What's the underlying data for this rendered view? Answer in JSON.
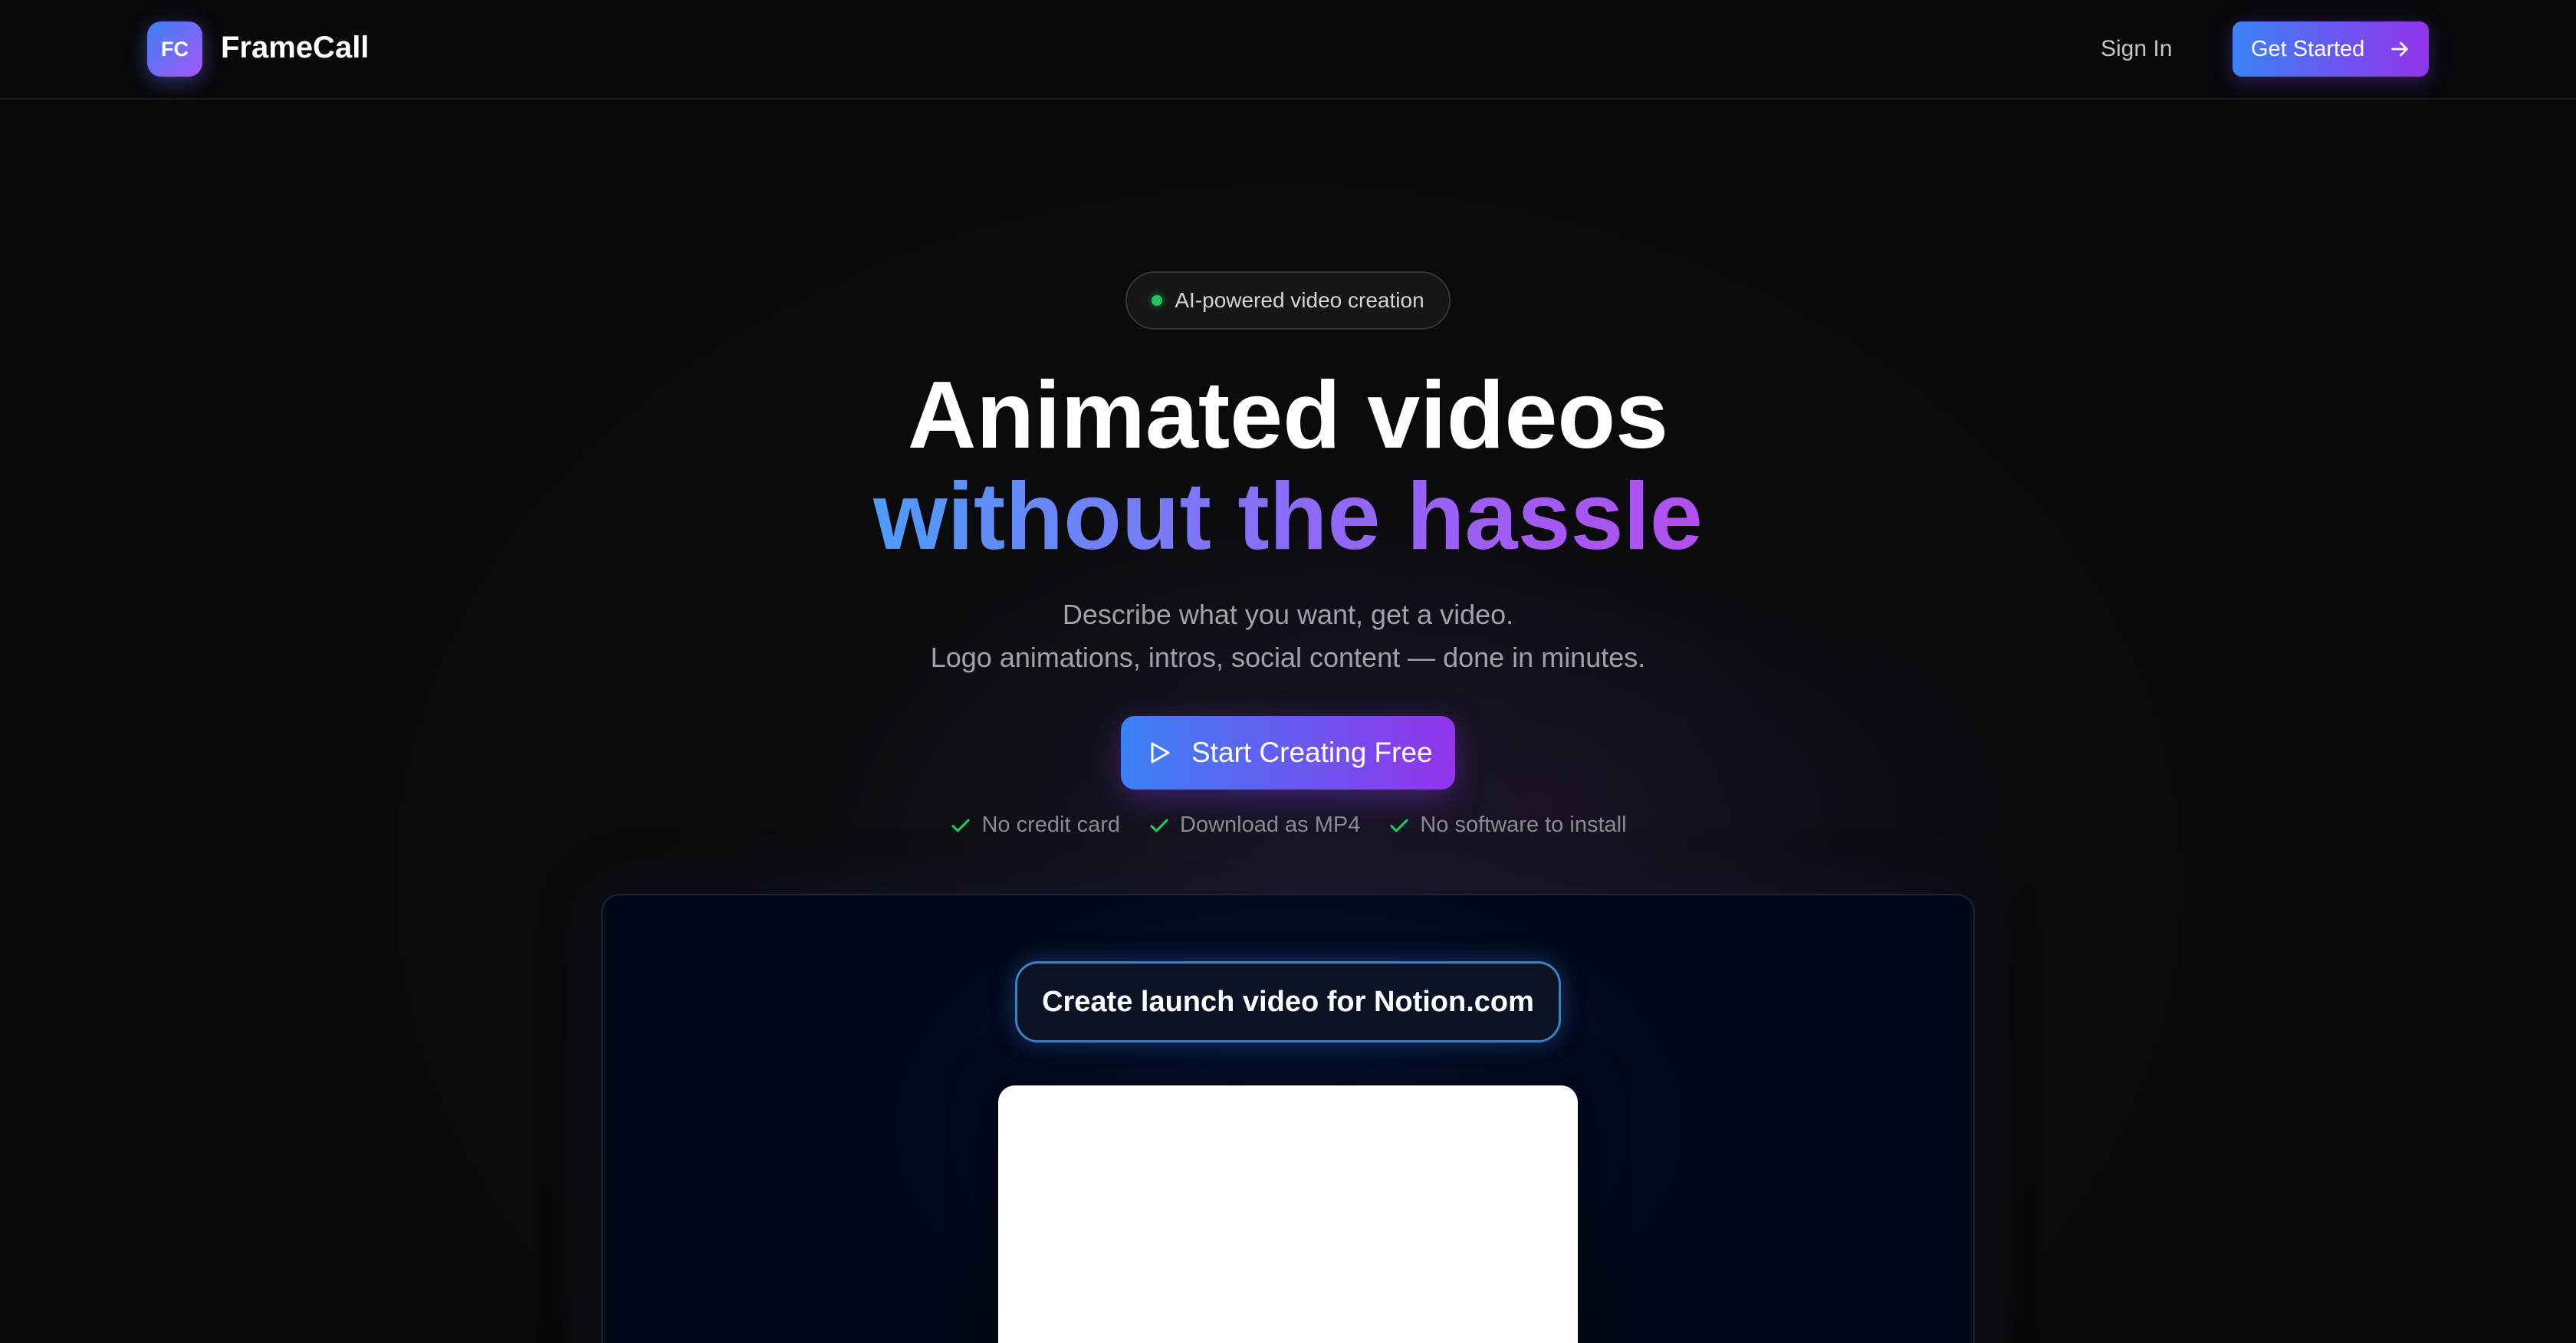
{
  "header": {
    "logo_initials": "FC",
    "brand_name": "FrameCall",
    "signin_label": "Sign In",
    "get_started_label": "Get Started"
  },
  "hero": {
    "badge_text": "AI-powered video creation",
    "title_line1": "Animated videos",
    "title_line2": "without the hassle",
    "subtitle_line1": "Describe what you want, get a video.",
    "subtitle_line2": "Logo animations, intros, social content — done in minutes.",
    "cta_label": "Start Creating Free",
    "checks": [
      "No credit card",
      "Download as MP4",
      "No software to install"
    ]
  },
  "preview": {
    "prompt_text": "Create launch video for Notion.com"
  },
  "colors": {
    "background": "#09090b",
    "accent_start": "#3b82f6",
    "accent_end": "#9333ea",
    "status_dot": "#22c55e",
    "check": "#22c55e"
  },
  "icons": {
    "cta": "play-icon",
    "get_started": "arrow-right-icon",
    "checks": "check-icon",
    "badge": "status-dot"
  }
}
